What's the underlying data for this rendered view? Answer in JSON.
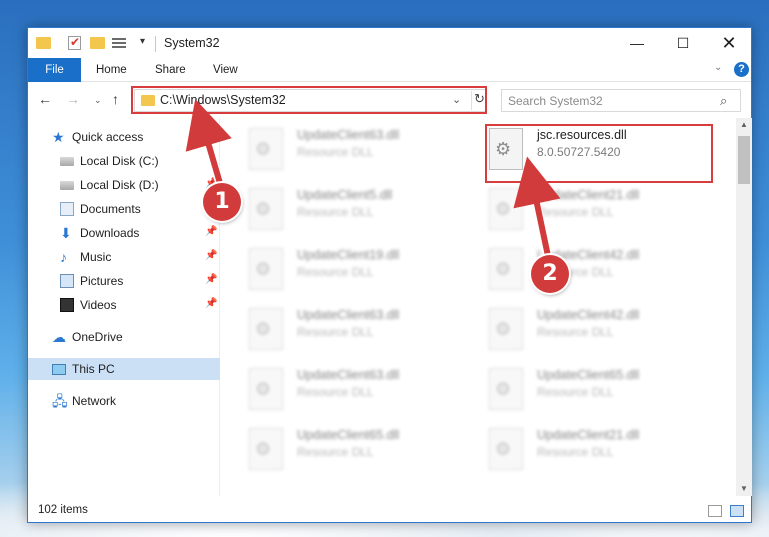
{
  "window": {
    "title": "System32",
    "min_icon": "minimize-icon",
    "max_icon": "maximize-icon",
    "close_icon": "close-icon"
  },
  "ribbon": {
    "tabs": [
      "File",
      "Home",
      "Share",
      "View"
    ],
    "help_label": "?"
  },
  "navigation": {
    "address_path": "C:\\Windows\\System32",
    "search_placeholder": "Search System32"
  },
  "sidebar": {
    "items": [
      {
        "label": "Quick access",
        "icon": "star-icon",
        "pinned": false
      },
      {
        "label": "Local Disk (C:)",
        "icon": "disk-icon",
        "pinned": false
      },
      {
        "label": "Local Disk (D:)",
        "icon": "disk-icon",
        "pinned": true
      },
      {
        "label": "Documents",
        "icon": "documents-icon",
        "pinned": true
      },
      {
        "label": "Downloads",
        "icon": "download-icon",
        "pinned": true
      },
      {
        "label": "Music",
        "icon": "music-icon",
        "pinned": true
      },
      {
        "label": "Pictures",
        "icon": "pictures-icon",
        "pinned": true
      },
      {
        "label": "Videos",
        "icon": "videos-icon",
        "pinned": true
      },
      {
        "label": "OneDrive",
        "icon": "onedrive-icon",
        "pinned": false
      },
      {
        "label": "This PC",
        "icon": "pc-icon",
        "pinned": false,
        "selected": true
      },
      {
        "label": "Network",
        "icon": "network-icon",
        "pinned": false
      }
    ]
  },
  "files": [
    {
      "name": "UpdateClient63.dll",
      "type": "Resource DLL",
      "blurred": true
    },
    {
      "name": "jsc.resources.dll",
      "type": "8.0.50727.5420",
      "blurred": false,
      "highlighted": true
    },
    {
      "name": "UpdateClient5.dll",
      "type": "Resource DLL",
      "blurred": true
    },
    {
      "name": "UpdateClient21.dll",
      "type": "Resource DLL",
      "blurred": true
    },
    {
      "name": "UpdateClient19.dll",
      "type": "Resource DLL",
      "blurred": true
    },
    {
      "name": "UpdateClient42.dll",
      "type": "Resource DLL",
      "blurred": true
    },
    {
      "name": "UpdateClient63.dll",
      "type": "Resource DLL",
      "blurred": true
    },
    {
      "name": "UpdateClient42.dll",
      "type": "Resource DLL",
      "blurred": true
    },
    {
      "name": "UpdateClient63.dll",
      "type": "Resource DLL",
      "blurred": true
    },
    {
      "name": "UpdateClient65.dll",
      "type": "Resource DLL",
      "blurred": true
    },
    {
      "name": "UpdateClient65.dll",
      "type": "Resource DLL",
      "blurred": true
    },
    {
      "name": "UpdateClient21.dll",
      "type": "Resource DLL",
      "blurred": true
    }
  ],
  "status": {
    "item_count": "102 items"
  },
  "annotations": {
    "callout_1": "1",
    "callout_2": "2",
    "highlight_color": "#d83c3c"
  }
}
